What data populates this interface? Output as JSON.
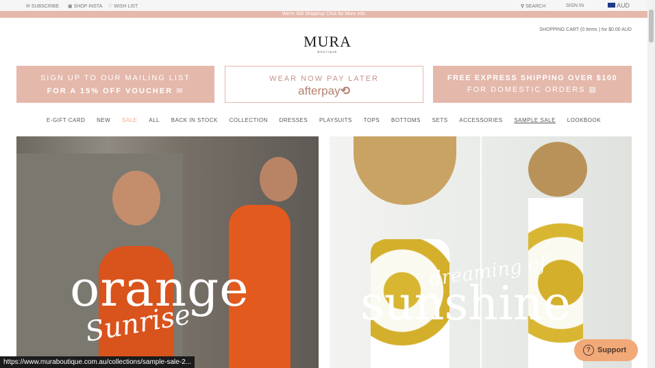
{
  "topbar": {
    "subscribe": "SUBSCRIBE",
    "shop_insta": "SHOP INSTA",
    "wish_list": "WISH LIST",
    "search": "SEARCH",
    "sign_in": "SIGN IN",
    "currency": "AUD"
  },
  "shipping_banner": "We're Still Shipping! Click for More Info",
  "cart": "SHOPPING CART (0 items ) for $0.00 AUD",
  "logo": {
    "name": "MURA",
    "sub": "BOUTIQUE"
  },
  "promos": [
    {
      "line1": "SIGN UP TO OUR MAILING LIST",
      "line2": "FOR A 15% OFF VOUCHER"
    },
    {
      "line1": "WEAR NOW PAY LATER",
      "line2": "afterpay"
    },
    {
      "line1": "FREE EXPRESS SHIPPING OVER $100",
      "line2": "FOR DOMESTIC ORDERS"
    }
  ],
  "nav": [
    "E-GIFT CARD",
    "NEW",
    "SALE",
    "ALL",
    "BACK IN STOCK",
    "COLLECTION",
    "DRESSES",
    "PLAYSUITS",
    "TOPS",
    "BOTTOMS",
    "SETS",
    "ACCESSORIES",
    "SAMPLE SALE",
    "LOOKBOOK"
  ],
  "heroes": [
    {
      "title": "orange",
      "script": "Sunrise"
    },
    {
      "title": "sunshine",
      "script": "dreaming of"
    }
  ],
  "status_url": "https://www.muraboutique.com.au/collections/sample-sale-2...",
  "support": "Support",
  "colors": {
    "accent": "#e4b8ab",
    "support": "#f2a978"
  }
}
